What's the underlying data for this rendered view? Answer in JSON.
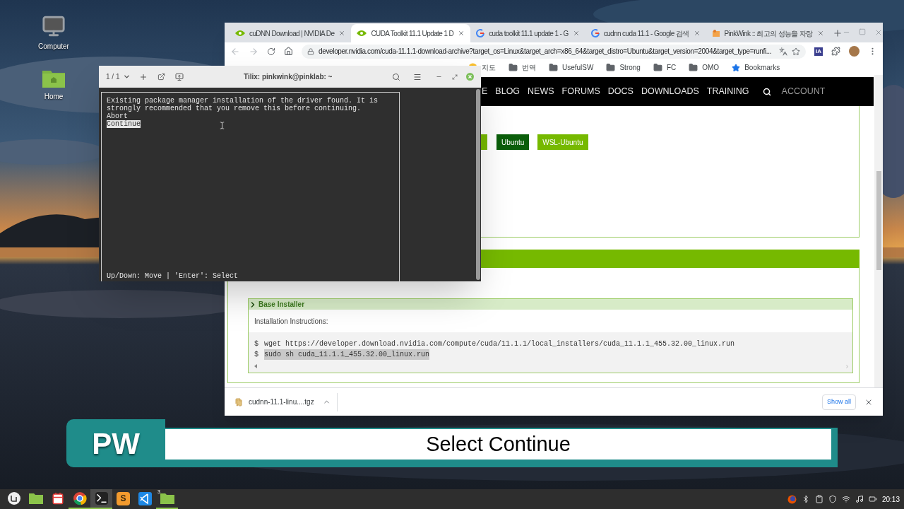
{
  "desktop": {
    "icons": [
      {
        "label": "Computer",
        "kind": "computer"
      },
      {
        "label": "Home",
        "kind": "home"
      }
    ]
  },
  "browser": {
    "tabs": [
      {
        "title": "cuDNN Download | NVIDIA De",
        "kind": "nvidia",
        "selected": false
      },
      {
        "title": "CUDA Toolkit 11.1 Update 1 D",
        "kind": "nvidia",
        "selected": true
      },
      {
        "title": "cuda toolkit 11.1 update 1 - G",
        "kind": "google",
        "selected": false
      },
      {
        "title": "cudnn cuda 11.1 - Google 검색",
        "kind": "google",
        "selected": false
      },
      {
        "title": "PinkWink :: 최고의 성능을 자랑",
        "kind": "blog",
        "selected": false
      }
    ],
    "address": "developer.nvidia.com/cuda-11.1.1-download-archive?target_os=Linux&target_arch=x86_64&target_distro=Ubuntu&target_version=2004&target_type=runfi...",
    "extension_label": "IA",
    "bookmarks": [
      {
        "label": "지도",
        "kind": "site"
      },
      {
        "label": "번역",
        "kind": "folder"
      },
      {
        "label": "UsefulSW",
        "kind": "folder"
      },
      {
        "label": "Strong",
        "kind": "folder"
      },
      {
        "label": "FC",
        "kind": "folder"
      },
      {
        "label": "OMO",
        "kind": "folder"
      },
      {
        "label": "Bookmarks",
        "kind": "star"
      }
    ],
    "nav": [
      "E",
      "BLOG",
      "NEWS",
      "FORUMS",
      "DOCS",
      "DOWNLOADS",
      "TRAINING"
    ],
    "account": "ACCOUNT",
    "distro_buttons": [
      {
        "label": "Ubuntu",
        "selected": true
      },
      {
        "label": "WSL-Ubuntu",
        "selected": false
      }
    ],
    "installer": {
      "title": "Base Installer",
      "instructions_label": "Installation Instructions:",
      "commands": [
        {
          "prompt": "$",
          "text": "wget https://developer.download.nvidia.com/compute/cuda/11.1.1/local_installers/cuda_11.1.1_455.32.00_linux.run",
          "highlighted": false
        },
        {
          "prompt": "$",
          "text": "sudo sh cuda_11.1.1_455.32.00_linux.run",
          "highlighted": true
        }
      ]
    },
    "download_bar": {
      "file": "cudnn-11.1-linu....tgz",
      "show_all": "Show all"
    }
  },
  "terminal": {
    "session_counter": "1 / 1",
    "title": "Tilix: pinkwink@pinklab: ~",
    "message": "Existing package manager installation of the driver found. It is strongly recommended that you remove this before continuing.",
    "options": [
      {
        "label": "Abort",
        "selected": false
      },
      {
        "label": "Continue",
        "selected": true
      }
    ],
    "hint": "Up/Down: Move | 'Enter': Select"
  },
  "caption": {
    "badge": "PW",
    "text": "Select Continue"
  },
  "taskbar": {
    "apps": [
      {
        "kind": "menu",
        "running": false,
        "active": false
      },
      {
        "kind": "files",
        "running": false,
        "active": false
      },
      {
        "kind": "calendar",
        "running": false,
        "active": false
      },
      {
        "kind": "chrome",
        "running": true,
        "active": false
      },
      {
        "kind": "terminal",
        "running": true,
        "active": true
      },
      {
        "kind": "sublime",
        "glyph": "S",
        "running": false,
        "active": false
      },
      {
        "kind": "vscode",
        "running": false,
        "active": false
      },
      {
        "kind": "folder",
        "badge": "3",
        "running": true,
        "active": false
      }
    ],
    "clock": "20:13"
  }
}
